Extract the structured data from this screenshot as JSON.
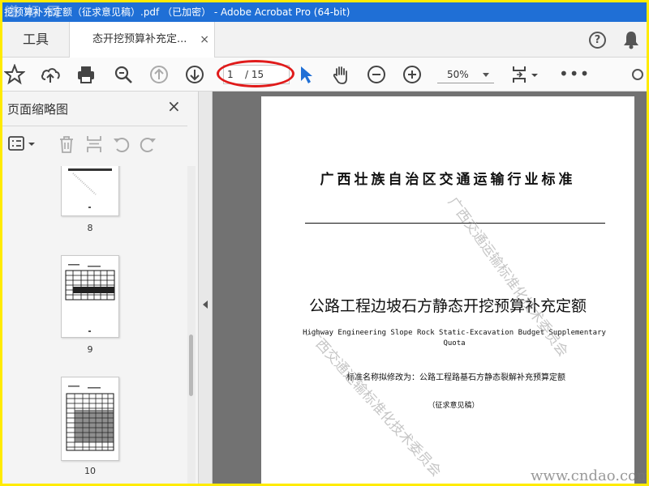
{
  "window": {
    "title": "挖预算补充定额（征求意见稿）.pdf （已加密） - Adobe Acrobat Pro (64-bit)",
    "watermark": "道 标 网"
  },
  "tabs": {
    "tools_label": "工具",
    "doc_label": "态开挖预算补充定...",
    "close_glyph": "×"
  },
  "header_icons": {
    "help": "?"
  },
  "toolbar": {
    "page_current": "1",
    "page_total": "/ 15",
    "zoom": "50%",
    "more": "•••"
  },
  "sidepanel": {
    "title": "页面缩略图",
    "close_glyph": "×",
    "thumbnails": [
      {
        "label": "8"
      },
      {
        "label": "9"
      },
      {
        "label": "10"
      }
    ]
  },
  "document": {
    "header": "广西壮族自治区交通运输行业标准",
    "title": "公路工程边坡石方静态开挖预算补充定额",
    "english_title": "Highway Engineering Slope Rock Static-Excavation Budget Supplementary Quota",
    "rename_note": "标准名称拟修改为：公路工程路基石方静态裂解补充预算定额",
    "draft_note": "（征求意见稿）",
    "watermark_1": "广西交通运输标准化技术委员会",
    "watermark_2": "广西交通运输标准化技术委员会",
    "site_watermark": "www.cndao.com"
  },
  "colors": {
    "titlebar": "#1f6fd6",
    "frame_border": "#ffeb00",
    "annotation_red": "#e01b1b",
    "cursor_blue": "#1f6fd6"
  },
  "icons": [
    "star-icon",
    "cloud-upload-icon",
    "printer-icon",
    "zoom-search-icon",
    "arrow-up-icon",
    "arrow-down-icon",
    "select-cursor-icon",
    "hand-icon",
    "zoom-out-icon",
    "zoom-in-icon",
    "page-fit-icon",
    "more-icon",
    "help-icon",
    "bell-icon",
    "options-icon",
    "trash-icon",
    "insert-page-icon",
    "rotate-left-icon",
    "rotate-right-icon"
  ]
}
